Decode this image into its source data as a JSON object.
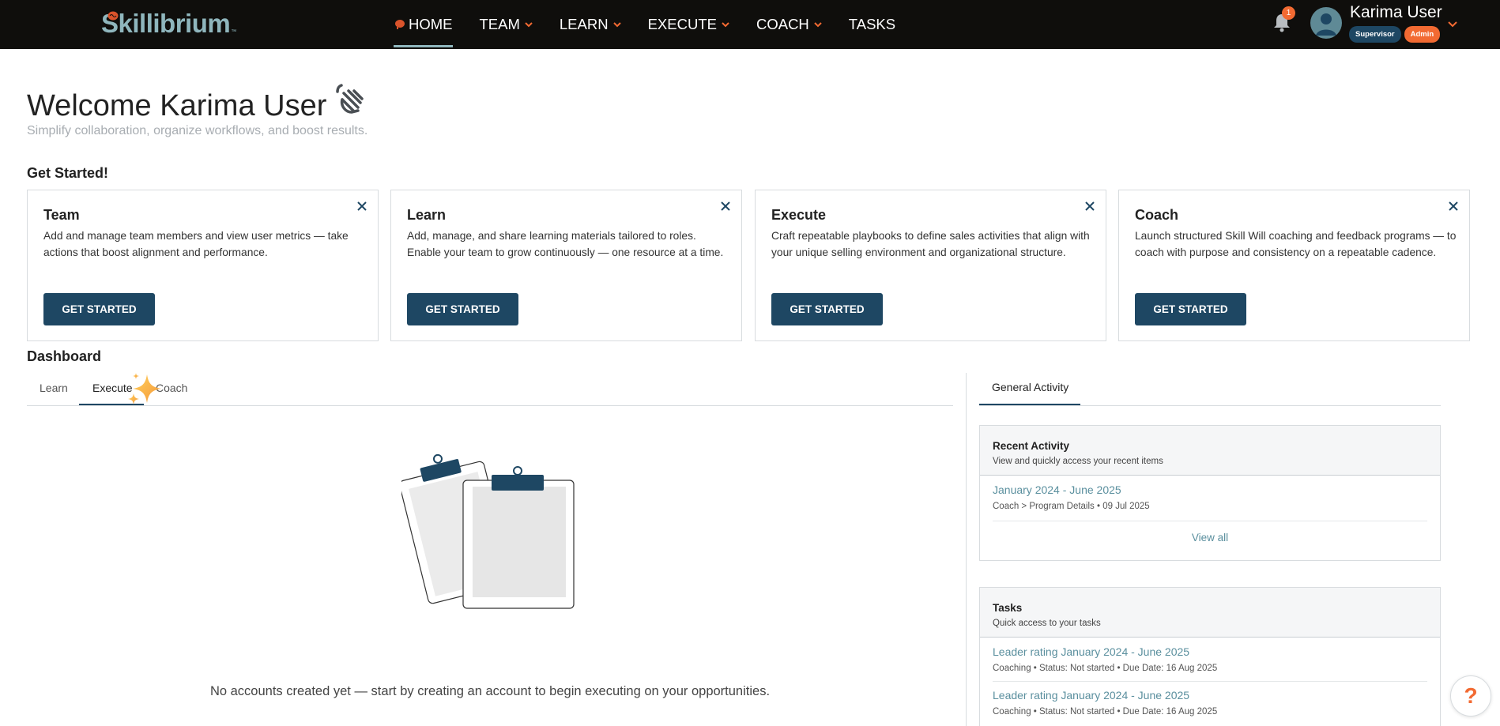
{
  "brand": {
    "logo_text": "Skillibrium",
    "logo_tm": "™"
  },
  "nav": {
    "items": [
      {
        "label": "HOME",
        "active": true,
        "has_dropdown": false
      },
      {
        "label": "TEAM",
        "active": false,
        "has_dropdown": true
      },
      {
        "label": "LEARN",
        "active": false,
        "has_dropdown": true
      },
      {
        "label": "EXECUTE",
        "active": false,
        "has_dropdown": true
      },
      {
        "label": "COACH",
        "active": false,
        "has_dropdown": true
      },
      {
        "label": "TASKS",
        "active": false,
        "has_dropdown": false
      }
    ]
  },
  "header": {
    "notification_count": "1",
    "user_name": "Karima User",
    "roles": [
      "Supervisor",
      "Admin"
    ]
  },
  "welcome": {
    "title": "Welcome Karima User",
    "subtitle": "Simplify collaboration, organize workflows, and boost results."
  },
  "get_started": {
    "heading": "Get Started!",
    "cards": [
      {
        "title": "Team",
        "description": "Add and manage team members and view user metrics —  take actions that boost alignment and performance.",
        "button": "GET STARTED"
      },
      {
        "title": "Learn",
        "description": "Add, manage, and share learning materials tailored to roles. Enable your team to grow continuously — one resource at a time.",
        "button": "GET STARTED"
      },
      {
        "title": "Execute",
        "description": "Craft repeatable playbooks to define sales activities that align with your unique selling environment and organizational structure.",
        "button": "GET STARTED"
      },
      {
        "title": "Coach",
        "description": "Launch structured Skill Will coaching and feedback programs — to coach with purpose and consistency on a repeatable cadence.",
        "button": "GET STARTED"
      }
    ]
  },
  "dashboard": {
    "heading": "Dashboard",
    "tabs": [
      {
        "label": "Learn",
        "active": false
      },
      {
        "label": "Execute",
        "active": true
      },
      {
        "label": "Coach",
        "active": false
      }
    ],
    "empty_message": "No accounts created yet — start by creating an account to begin executing on your opportunities."
  },
  "activity": {
    "tab_label": "General Activity",
    "recent": {
      "title": "Recent Activity",
      "subtitle": "View and quickly access your recent items",
      "items": [
        {
          "title": "January 2024 - June 2025",
          "meta": "Coach > Program Details • 09 Jul 2025"
        }
      ],
      "view_all": "View all"
    },
    "tasks": {
      "title": "Tasks",
      "subtitle": "Quick access to your tasks",
      "items": [
        {
          "title": "Leader rating January 2024 - June 2025",
          "meta": "Coaching • Status: Not started • Due Date: 16 Aug 2025"
        },
        {
          "title": "Leader rating January 2024 - June 2025",
          "meta": "Coaching • Status: Not started • Due Date: 16 Aug 2025"
        }
      ]
    }
  },
  "help": {
    "label": "?"
  },
  "colors": {
    "primary": "#1e4763",
    "accent": "#f26a32",
    "link": "#5a8f9e",
    "topbar": "#0f0e0c"
  }
}
